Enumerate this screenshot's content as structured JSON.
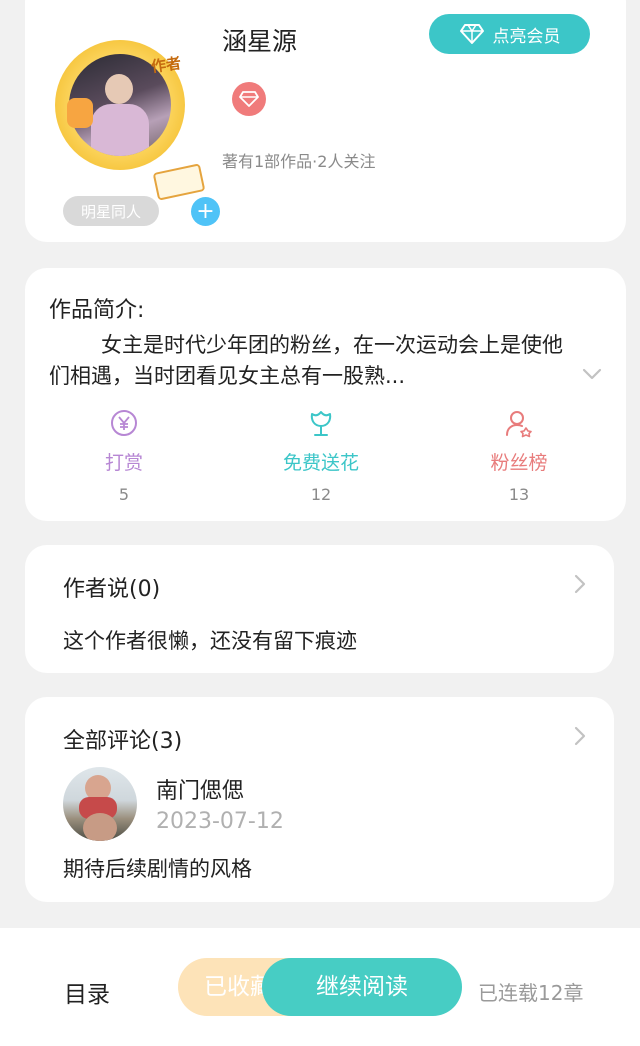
{
  "author": {
    "name": "涵星源",
    "avatar_tag": "作者",
    "vip_button": "点亮会员",
    "works_stat": "著有1部作品·2人关注",
    "tag": "明星同人",
    "add_tag": "+"
  },
  "intro": {
    "title": "作品简介:",
    "text": "女主是时代少年团的粉丝，在一次运动会上是使他们相遇，当时团看见女主总有一股熟...",
    "stats": [
      {
        "label": "打赏",
        "count": "5",
        "color": "#b787d4",
        "icon": "yuan-coin-icon"
      },
      {
        "label": "免费送花",
        "count": "12",
        "color": "#3cc6c8",
        "icon": "flower-icon"
      },
      {
        "label": "粉丝榜",
        "count": "13",
        "color": "#e87c7c",
        "icon": "fan-rank-icon"
      }
    ]
  },
  "author_says": {
    "title": "作者说(0)",
    "text": "这个作者很懒，还没有留下痕迹"
  },
  "comments": {
    "title": "全部评论(3)",
    "items": [
      {
        "user": "南门偲偲",
        "date": "2023-07-12",
        "text": "期待后续剧情的风格"
      }
    ]
  },
  "bottom_bar": {
    "toc": "目录",
    "favorite": "已收藏",
    "continue_reading": "继续阅读",
    "chapters": "已连载12章"
  },
  "colors": {
    "accent": "#3cc6c8",
    "background": "#f1f1f1"
  }
}
